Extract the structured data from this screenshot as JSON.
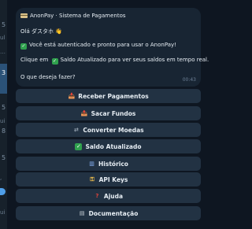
{
  "sidebar": {
    "numbers": [
      "5",
      "3",
      "5",
      "8",
      "5"
    ],
    "active_number": "3",
    "fragments": [
      "ul",
      "ui",
      "ui"
    ]
  },
  "message": {
    "header_title": "AnonPay · Sistema de Pagamentos",
    "greeting": "Olá ダスタホ 👋",
    "auth_line": "Você está autenticado e pronto para usar o AnonPay!",
    "balance_prefix": "Clique em",
    "balance_suffix": "Saldo Atualizado para ver seus saldos em tempo real.",
    "question": "O que deseja fazer?",
    "time": "00:43"
  },
  "keyboard": [
    {
      "label": "Receber Pagamentos",
      "icon": "inbox-tray-icon",
      "color": "#8ab4f8"
    },
    {
      "label": "Sacar Fundos",
      "icon": "outbox-tray-icon",
      "color": "#8ab4f8"
    },
    {
      "label": "Converter Moedas",
      "icon": "exchange-icon",
      "color": "#9aa7b4"
    },
    {
      "label": "Saldo Atualizado",
      "icon": "check-icon",
      "color": "#30a14e"
    },
    {
      "label": "Histórico",
      "icon": "chart-icon",
      "color": "#8ab4f8"
    },
    {
      "label": "API Keys",
      "icon": "key-icon",
      "color": "#f2c14e"
    },
    {
      "label": "Ajuda",
      "icon": "question-icon",
      "color": "#e0433b"
    },
    {
      "label": "Documentação",
      "icon": "book-icon",
      "color": "#c9d1d9"
    }
  ]
}
